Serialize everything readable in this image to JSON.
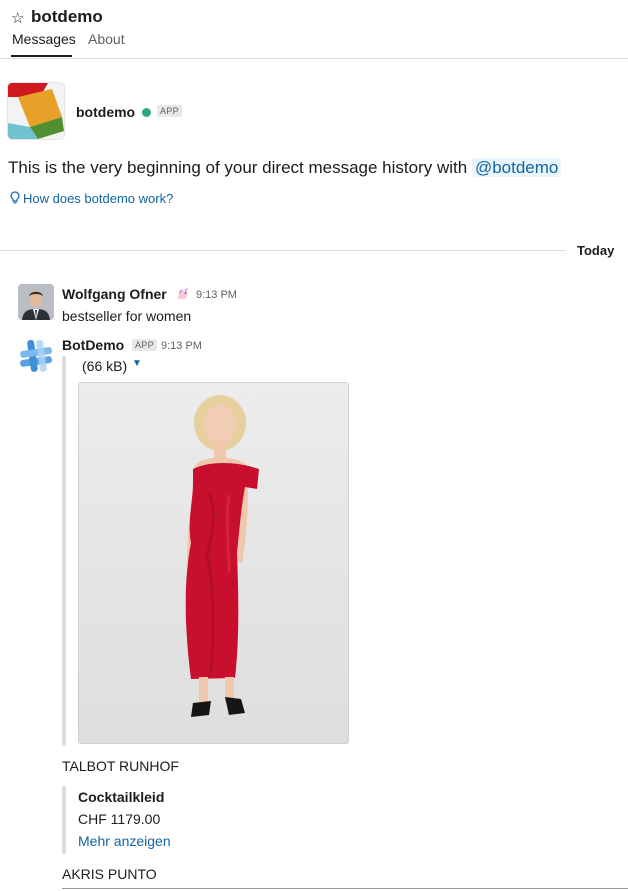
{
  "header": {
    "channel_name": "botdemo",
    "tabs": [
      {
        "label": "Messages",
        "active": true
      },
      {
        "label": "About",
        "active": false
      }
    ]
  },
  "intro": {
    "name": "botdemo",
    "badge": "APP",
    "text_prefix": "This is the very beginning of your direct message history with ",
    "mention": "@botdemo",
    "help_link": "How does botdemo work?"
  },
  "divider": {
    "label": "Today"
  },
  "messages": [
    {
      "sender": "Wolfgang Ofner",
      "time": "9:13 PM",
      "text": "bestseller for women",
      "emoji": "unicorn-icon"
    },
    {
      "sender": "BotDemo",
      "badge": "APP",
      "time": "9:13 PM",
      "file_size": "(66 kB)",
      "items": [
        {
          "brand": "TALBOT RUNHOF",
          "title": "Cocktailkleid",
          "price": "CHF 1179.00",
          "link": "Mehr anzeigen"
        },
        {
          "brand": "AKRIS PUNTO"
        }
      ]
    }
  ],
  "colors": {
    "link": "#1264a3",
    "online": "#2bac76",
    "dress": "#c8102e"
  }
}
